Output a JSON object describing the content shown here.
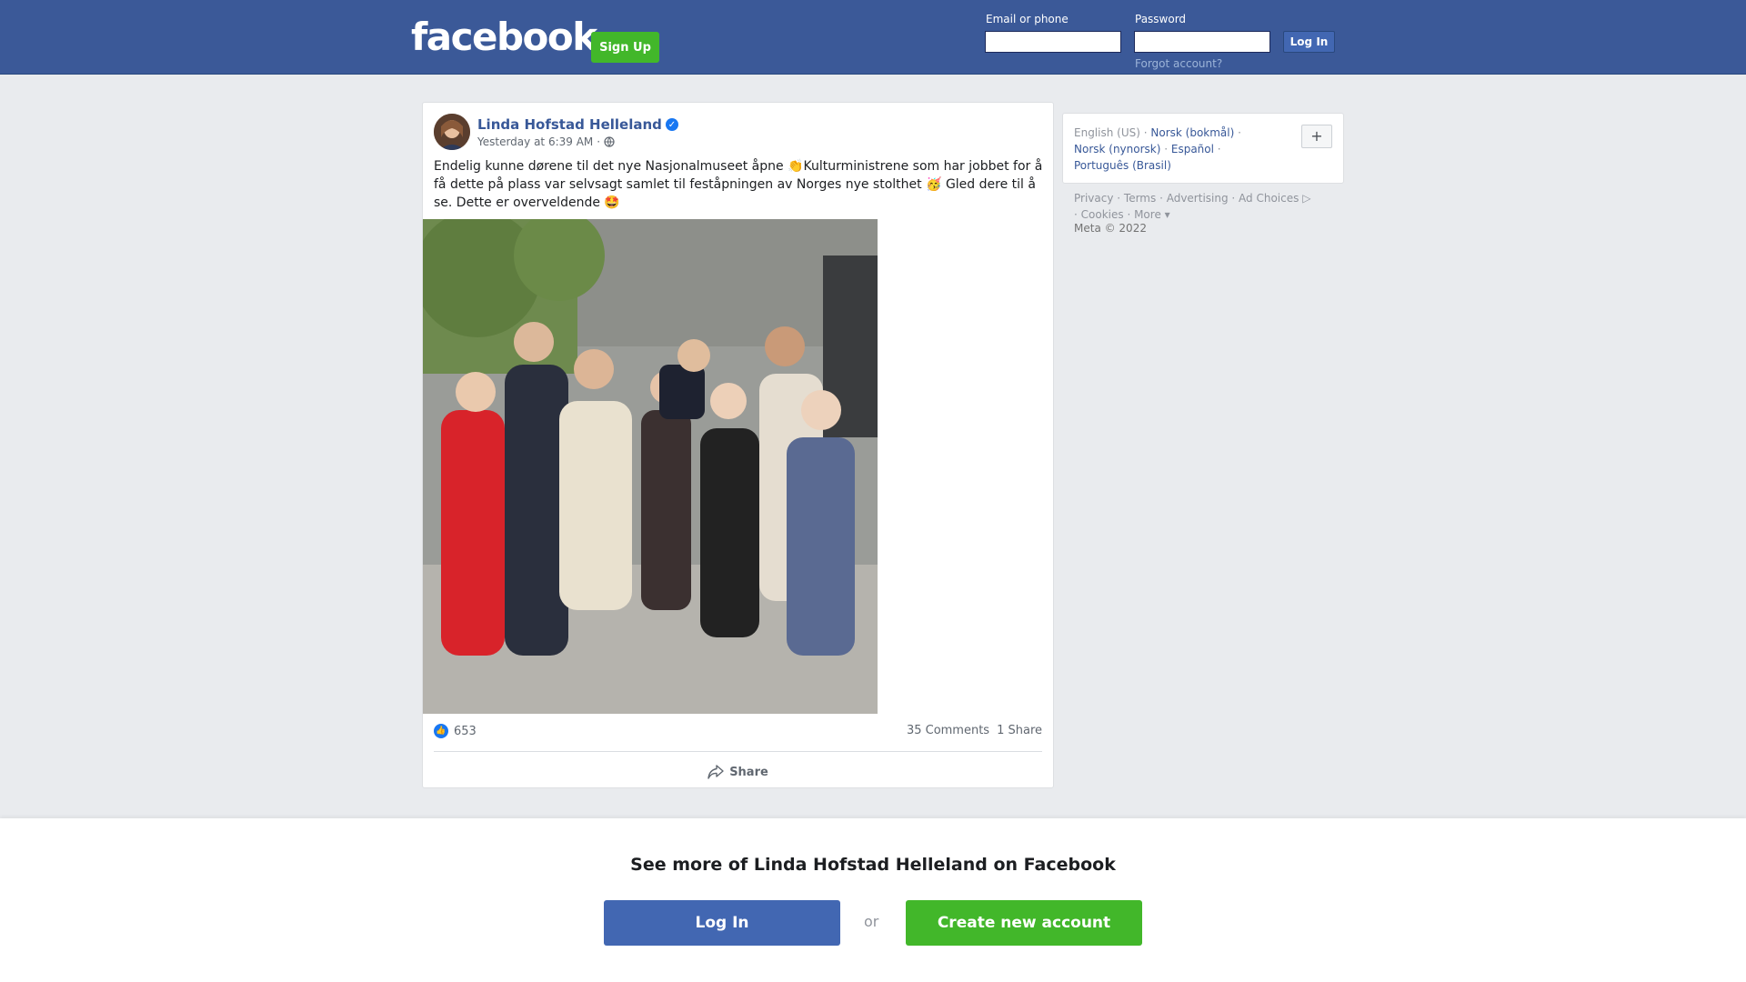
{
  "header": {
    "logo": "facebook",
    "signup_label": "Sign Up",
    "email_label": "Email or phone",
    "password_label": "Password",
    "login_label": "Log In",
    "forgot_label": "Forgot account?"
  },
  "post": {
    "author": "Linda Hofstad Helleland",
    "timestamp": "Yesterday at 6:39 AM",
    "separator": "·",
    "text": "Endelig kunne dørene til det nye Nasjonalmuseet åpne 👏Kulturministrene som har jobbet for å få dette på plass var selvsagt samlet til feståpningen av Norges nye stolthet 🥳 Gled dere til å se. Dette er overveldende 🤩",
    "reactions_count": "653",
    "comments": "35 Comments",
    "shares": "1 Share",
    "share_label": "Share"
  },
  "languages": {
    "current": "English (US)",
    "options": [
      "Norsk (bokmål)",
      "Norsk (nynorsk)",
      "Español",
      "Português (Brasil)"
    ],
    "more_label": "+"
  },
  "footer": {
    "links": [
      "Privacy",
      "Terms",
      "Advertising",
      "Ad Choices",
      "Cookies",
      "More"
    ],
    "copyright": "Meta © 2022"
  },
  "banner": {
    "title": "See more of Linda Hofstad Helleland on Facebook",
    "login_label": "Log In",
    "or_label": "or",
    "create_label": "Create new account"
  },
  "colors": {
    "brand": "#3b5998",
    "signup_green": "#42b72a",
    "link_blue": "#385898",
    "verified_blue": "#1877f2"
  }
}
